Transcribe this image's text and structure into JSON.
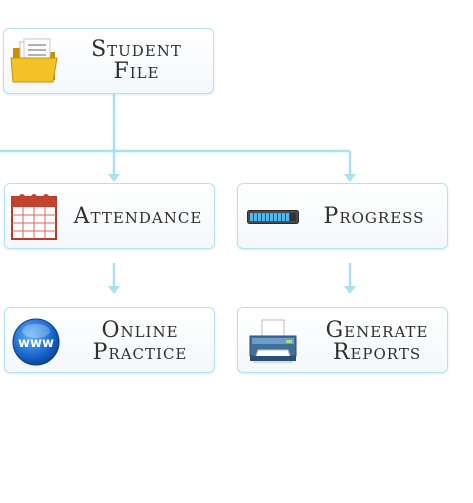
{
  "nodes": {
    "student_file": {
      "line1": "Student",
      "line2": "File"
    },
    "attendance": {
      "label": "Attendance"
    },
    "progress": {
      "label": "Progress"
    },
    "online_practice": {
      "line1": "Online",
      "line2": "Practice"
    },
    "generate_reports": {
      "line1": "Generate",
      "line2": "Reports"
    }
  },
  "icons": {
    "student_file": "folder-icon",
    "attendance": "calendar-icon",
    "progress": "progress-bar-icon",
    "online_practice": "www-globe-icon",
    "generate_reports": "printer-icon"
  },
  "web_badge_text": "www",
  "colors": {
    "connector": "#a8e1f3",
    "border": "#b4e2f2",
    "text": "#2f2f2f"
  }
}
